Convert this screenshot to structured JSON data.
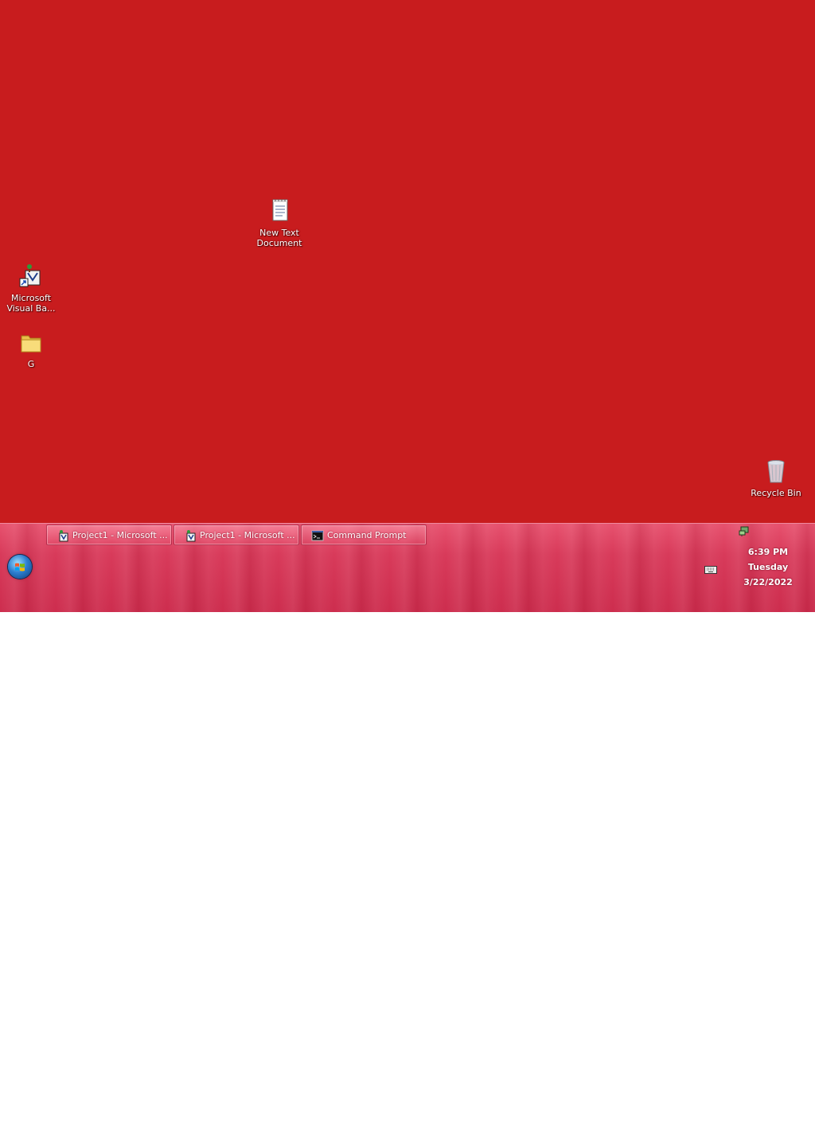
{
  "desktop": {
    "background_color": "#c81c1e",
    "icons": [
      {
        "label": "New Text\nDocument",
        "icon": "notepad-icon"
      },
      {
        "label": "Microsoft\nVisual Ba...",
        "icon": "visual-basic-shortcut-icon"
      },
      {
        "label": "G",
        "icon": "folder-icon"
      },
      {
        "label": "Recycle Bin",
        "icon": "recycle-bin-icon"
      }
    ]
  },
  "taskbar": {
    "buttons": [
      {
        "label": "Project1 - Microsoft ...",
        "icon": "visual-basic-icon"
      },
      {
        "label": "Project1 - Microsoft ...",
        "icon": "visual-basic-icon"
      },
      {
        "label": "Command Prompt",
        "icon": "command-prompt-icon"
      }
    ],
    "clock": {
      "time": "6:39 PM",
      "day": "Tuesday",
      "date": "3/22/2022"
    },
    "tray_icons": [
      "network-icon",
      "keyboard-icon"
    ]
  }
}
